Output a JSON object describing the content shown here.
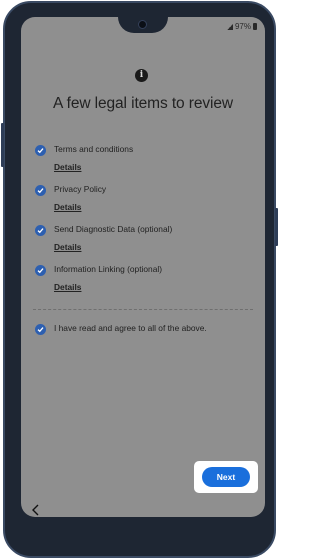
{
  "status_bar": {
    "battery_text": "97%"
  },
  "screen": {
    "title": "A few legal items to review",
    "items": [
      {
        "label": "Terms and conditions",
        "details_label": "Details",
        "checked": true
      },
      {
        "label": "Privacy Policy",
        "details_label": "Details",
        "checked": true
      },
      {
        "label": "Send Diagnostic Data (optional)",
        "details_label": "Details",
        "checked": true
      },
      {
        "label": "Information Linking (optional)",
        "details_label": "Details",
        "checked": true
      }
    ],
    "agree_all": {
      "label": "I have read and agree to all of the above.",
      "checked": true
    },
    "next_label": "Next"
  },
  "icons": {
    "info": "info-icon",
    "check": "check-icon",
    "back": "back-arrow-icon"
  },
  "colors": {
    "checkbox": "#2d5fb0",
    "primary_button": "#1a6fdc",
    "overlay_background": "#8f8f8f"
  }
}
